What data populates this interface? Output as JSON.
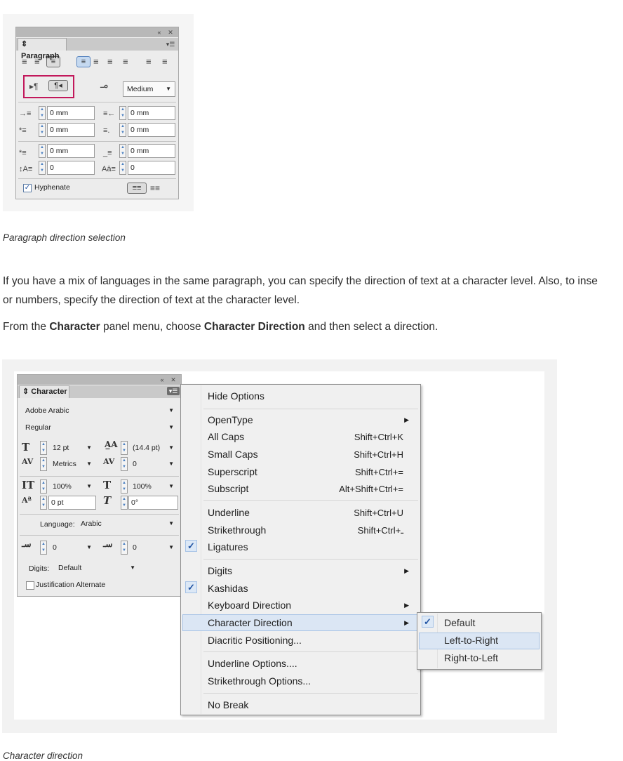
{
  "paragraph_panel": {
    "title": "Paragraph",
    "direction_dropdown": "Medium",
    "fields": {
      "left_indent": "0 mm",
      "right_indent": "0 mm",
      "first_line_indent": "0 mm",
      "last_line_indent": "0 mm",
      "space_before": "0 mm",
      "space_after": "0 mm",
      "drop_cap_lines": "0",
      "drop_cap_chars": "0"
    },
    "hyphenate_label": "Hyphenate"
  },
  "caption1": "Paragraph direction selection",
  "paragraph1": {
    "line1": "If you have a mix of languages in the same paragraph, you can specify the direction of text at a character level. Also, to inse",
    "line2": "or numbers, specify the direction of text at the character level."
  },
  "paragraph2": {
    "prefix": "From the ",
    "bold1": "Character",
    "mid": " panel menu, choose ",
    "bold2": "Character Direction",
    "suffix": " and then select a direction."
  },
  "character_panel": {
    "title": "Character",
    "font_family": "Adobe Arabic",
    "font_style": "Regular",
    "font_size": "12 pt",
    "leading": "(14.4 pt)",
    "kerning": "Metrics",
    "tracking": "0",
    "vertical_scale": "100%",
    "horizontal_scale": "100%",
    "baseline_shift": "0 pt",
    "skew": "0°",
    "language_label": "Language:",
    "language": "Arabic",
    "kashida1": "0",
    "kashida2": "0",
    "digits_label": "Digits:",
    "digits": "Default",
    "justification_alternate": "Justification Alternate"
  },
  "menu": {
    "hide_options": "Hide Options",
    "opentype": "OpenType",
    "all_caps": "All Caps",
    "all_caps_sc": "Shift+Ctrl+K",
    "small_caps": "Small Caps",
    "small_caps_sc": "Shift+Ctrl+H",
    "superscript": "Superscript",
    "superscript_sc": "Shift+Ctrl+=",
    "subscript": "Subscript",
    "subscript_sc": "Alt+Shift+Ctrl+=",
    "underline": "Underline",
    "underline_sc": "Shift+Ctrl+U",
    "strikethrough": "Strikethrough",
    "strikethrough_sc": "Shift+Ctrl+ـ",
    "ligatures": "Ligatures",
    "digits": "Digits",
    "kashidas": "Kashidas",
    "keyboard_direction": "Keyboard Direction",
    "character_direction": "Character Direction",
    "diacritic_positioning": "Diacritic Positioning...",
    "underline_options": "Underline Options....",
    "strikethrough_options": "Strikethrough Options...",
    "no_break": "No Break"
  },
  "submenu": {
    "default": "Default",
    "ltr": "Left-to-Right",
    "rtl": "Right-to-Left"
  },
  "caption2": "Character direction",
  "colors": {
    "highlight_frame": "#c2185b",
    "menu_highlight": "#dbe6f4",
    "check": "#2456a4"
  }
}
